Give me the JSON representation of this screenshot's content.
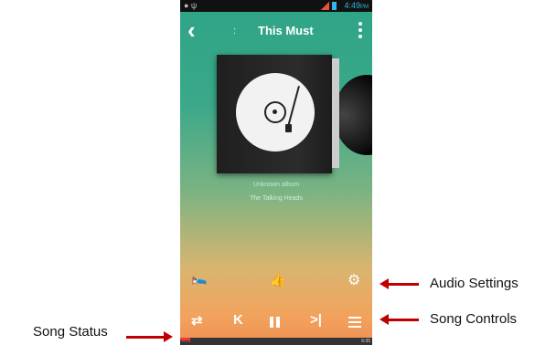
{
  "status_bar": {
    "time": "4:49",
    "ampm": "PM",
    "left_icons": "● ψ"
  },
  "header": {
    "back_icon": "chevron-left-icon",
    "separator": ":",
    "title": "This Must",
    "menu_icon": "more-vertical-icon"
  },
  "track": {
    "album": "Unknown album",
    "artist": "The Talking Heads"
  },
  "utility_row": {
    "sleep_icon": "sleep-timer-icon",
    "like_icon": "thumbs-up-icon",
    "settings_icon": "gear-icon"
  },
  "controls": {
    "repeat_icon": "repeat-icon",
    "prev_icon": "previous-icon",
    "pause_icon": "pause-icon",
    "next_icon": "next-icon",
    "list_icon": "list-icon"
  },
  "progress": {
    "elapsed": "0:21",
    "total": "6:35",
    "fraction": 0.053
  },
  "annotations": {
    "audio_settings": "Audio Settings",
    "song_controls": "Song Controls",
    "song_status": "Song Status"
  },
  "colors": {
    "arrow": "#c00000",
    "accent": "#33b5e5"
  }
}
